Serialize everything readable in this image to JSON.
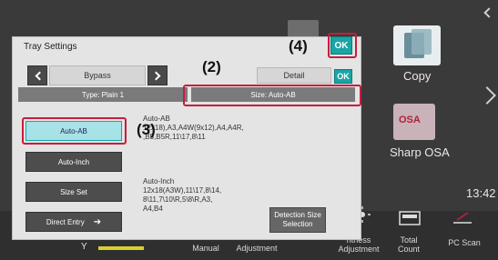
{
  "home": {
    "copy_label": "Copy",
    "osa_tile_text": "OSA",
    "osa_label": "Sharp OSA",
    "clock": "13:42",
    "bottom": {
      "y_label": "Y",
      "manual": "Manual",
      "adjustment": "Adjustment",
      "brightness": "htness\nAdjustment",
      "total_count": "Total\nCount",
      "pc_scan": "PC Scan"
    }
  },
  "dialog": {
    "title": "Tray Settings",
    "ok_label": "OK",
    "tab_bypass": "Bypass",
    "tab_detail": "Detail",
    "type": "Type: Plain 1",
    "size": "Size: Auto-AB",
    "buttons": {
      "auto_ab": "Auto-AB",
      "auto_inch": "Auto-Inch",
      "size_set": "Size Set",
      "direct_entry": "Direct Entry"
    },
    "info_ab_title": "Auto-AB",
    "info_ab_body": "12x18),A3,A4W(9x12),A4,A4R,\n,B5,B5R,11\\17,8\\11",
    "info_inch_title": "Auto-Inch",
    "info_inch_body": "12x18(A3W),11\\17,8\\14,\n8\\11,7\\10\\R,5\\8\\R,A3,\nA4,B4",
    "detect": "Detection Size\nSelection"
  },
  "callouts": {
    "n2": "(2)",
    "n3": "(3)",
    "n4": "(4)"
  },
  "colors": {
    "accent": "#1aa5a5",
    "callout": "#c81d3c",
    "selected_fill": "#a7e2e6"
  }
}
